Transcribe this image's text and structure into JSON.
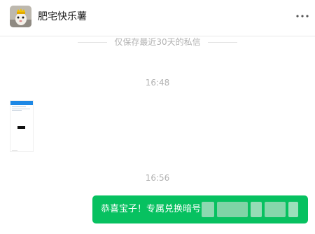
{
  "header": {
    "title": "肥宅快乐薯",
    "more_icon": "more-icon"
  },
  "notice": {
    "retention": "仅保存最近30天的私信"
  },
  "messages": [
    {
      "time": "16:48",
      "type": "image"
    },
    {
      "time": "16:56",
      "type": "text",
      "text": "恭喜宝子！专属兑换暗号"
    }
  ],
  "colors": {
    "bubble": "#07c160",
    "muted": "#b2b2b2",
    "divider": "#e9e9e9"
  }
}
